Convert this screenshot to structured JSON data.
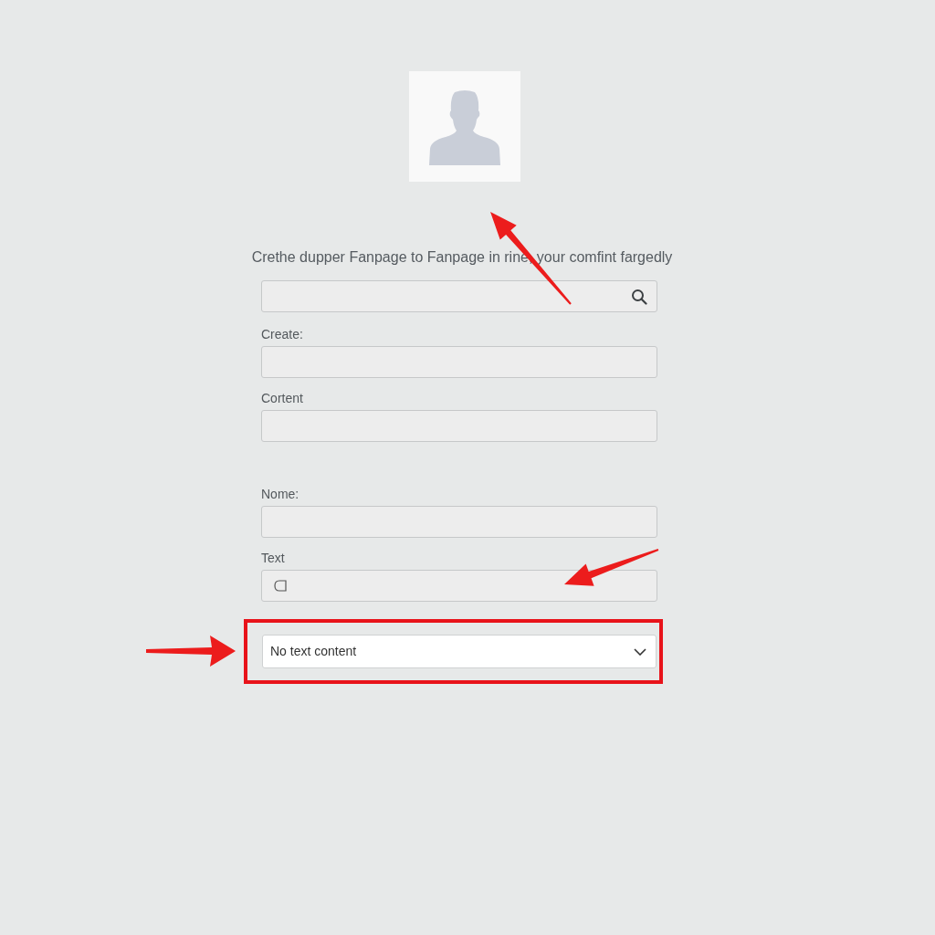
{
  "heading": "Crethe dupper Fanpage to Fanpage in rine, your comfint fargedly",
  "search": {
    "kind": "search"
  },
  "sections": [
    [
      {
        "label": "Create:",
        "kind": "plain"
      },
      {
        "label": "Cortent",
        "kind": "plain"
      }
    ],
    [
      {
        "label": "Nome:",
        "kind": "plain"
      },
      {
        "label": "Text",
        "kind": "with_icon"
      }
    ]
  ],
  "dropdown": {
    "value": "No text content",
    "highlighted": true
  }
}
